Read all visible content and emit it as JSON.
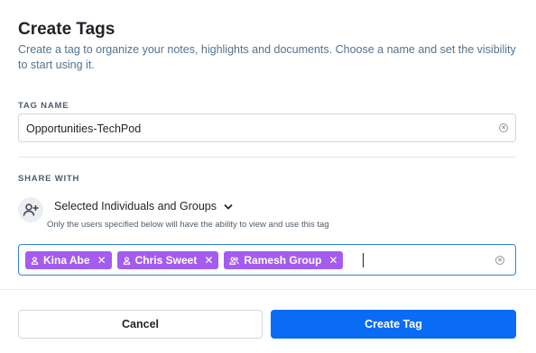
{
  "dialog": {
    "title": "Create Tags",
    "description": "Create a tag to organize your notes, highlights and documents. Choose a name and set the visibility to start using it."
  },
  "tag_name": {
    "label": "TAG NAME",
    "value": "Opportunities-TechPod",
    "clear_icon": "clear-circle-icon"
  },
  "share": {
    "label": "SHARE WITH",
    "avatar_icon": "add-user-icon",
    "selected": "Selected Individuals and Groups",
    "dropdown_icon": "chevron-down-icon",
    "help": "Only the users specified below will have the ability to view and use this tag",
    "chips": [
      {
        "label": "Kina Abe",
        "icon": "person-icon",
        "type": "individual"
      },
      {
        "label": "Chris Sweet",
        "icon": "person-icon",
        "type": "individual"
      },
      {
        "label": "Ramesh Group",
        "icon": "group-icon",
        "type": "group"
      }
    ],
    "chip_color": "#a45cf0",
    "field_border_color": "#2f80ed"
  },
  "actions": {
    "cancel": "Cancel",
    "create": "Create Tag",
    "primary_color": "#0a6cf5"
  }
}
